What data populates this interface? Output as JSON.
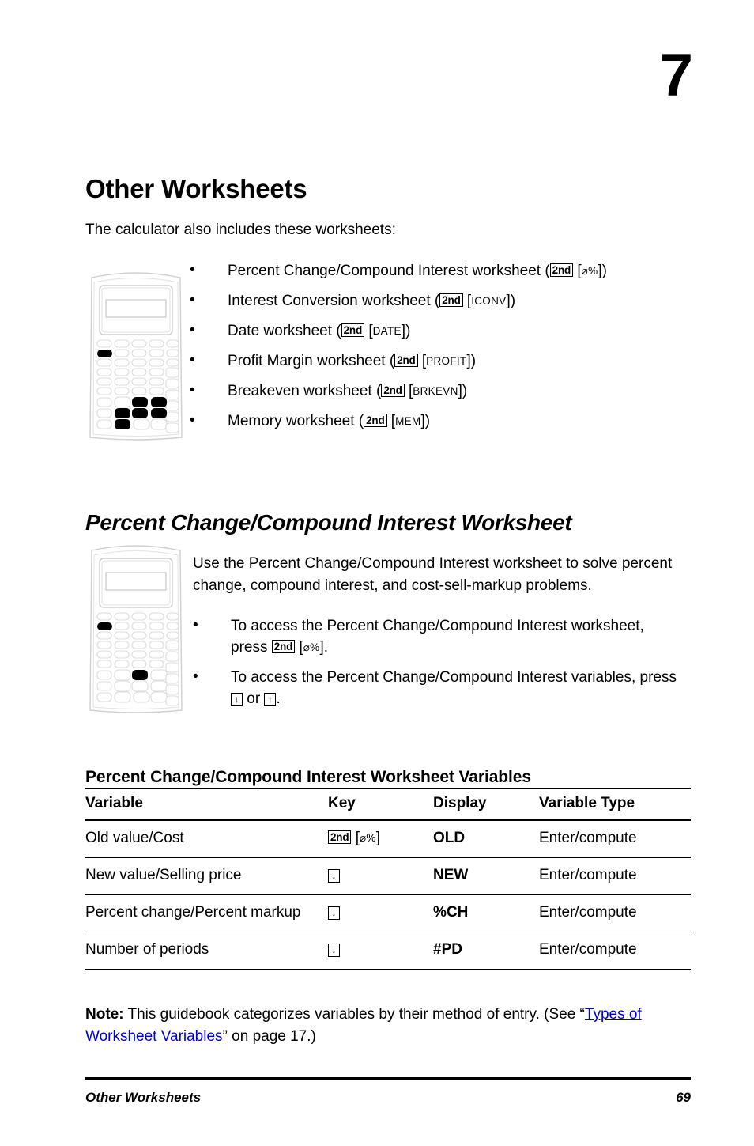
{
  "chapter": {
    "number": "7"
  },
  "page": {
    "title": "Other Worksheets",
    "intro": "The calculator also includes these worksheets:"
  },
  "worksheet_list": [
    {
      "text_before": "Percent Change/Compound Interest worksheet (",
      "keys": [
        "2nd",
        "⌀%"
      ],
      "text_after": ")",
      "line1": "Percent Change/Compound Interest worksheet",
      "key_second": "2nd",
      "key_label": "⌀%"
    },
    {
      "line1": "Interest Conversion worksheet (",
      "key_second": "2nd",
      "key_label": "ICONV",
      "text_after": ")"
    },
    {
      "line1": "Date worksheet (",
      "key_second": "2nd",
      "key_label": "DATE",
      "text_after": ")"
    },
    {
      "line1": "Profit Margin worksheet (",
      "key_second": "2nd",
      "key_label": "PROFIT",
      "text_after": ")"
    },
    {
      "line1": "Breakeven worksheet (",
      "key_second": "2nd",
      "key_label": "BRKEVN",
      "text_after": ")"
    },
    {
      "line1": "Memory worksheet (",
      "key_second": "2nd",
      "key_label": "MEM",
      "text_after": ")"
    }
  ],
  "section": {
    "heading": "Percent Change/Compound Interest Worksheet",
    "paragraph": "Use the Percent Change/Compound Interest worksheet to solve percent change, compound interest, and cost-sell-markup problems.",
    "bullets": [
      {
        "text_before": "To access the Percent Change/Compound Interest worksheet, press ",
        "key_second": "2nd",
        "key_label": "⌀%",
        "text_after": "."
      },
      {
        "text_before": "To access the Percent Change/Compound Interest variables, press ",
        "arrow_down": "↓",
        "text_middle": " or ",
        "arrow_up": "↑",
        "text_after": "."
      }
    ]
  },
  "table": {
    "heading": "Percent Change/Compound Interest Worksheet Variables",
    "columns": [
      "Variable",
      "Key",
      "Display",
      "Variable Type"
    ],
    "rows": [
      {
        "variable": "Old value/Cost",
        "key_second": "2nd",
        "key_label": "⌀%",
        "key_kind": "second",
        "display": "OLD",
        "type": "Enter/compute"
      },
      {
        "variable": "New value/Selling price",
        "key_arrow": "↓",
        "key_kind": "arrow",
        "display": "NEW",
        "type": "Enter/compute"
      },
      {
        "variable": "Percent change/Percent markup",
        "key_arrow": "↓",
        "key_kind": "arrow",
        "display": "%CH",
        "type": "Enter/compute"
      },
      {
        "variable": "Number of periods",
        "key_arrow": "↓",
        "key_kind": "arrow",
        "display": "#PD",
        "type": "Enter/compute"
      }
    ]
  },
  "note": {
    "label": "Note:",
    "text_before": " This guidebook categorizes variables by their method of entry. (See “",
    "link": "Types of Worksheet Variables",
    "text_after": "” on page 17.)"
  },
  "footer": {
    "left": "Other Worksheets",
    "right": "69"
  },
  "colors": {
    "link": "#0000cc",
    "text": "#000000",
    "calc_outline": "#d9d9d9",
    "calc_key_fill": "#ffffff",
    "calc_key_highlight": "#000000"
  }
}
